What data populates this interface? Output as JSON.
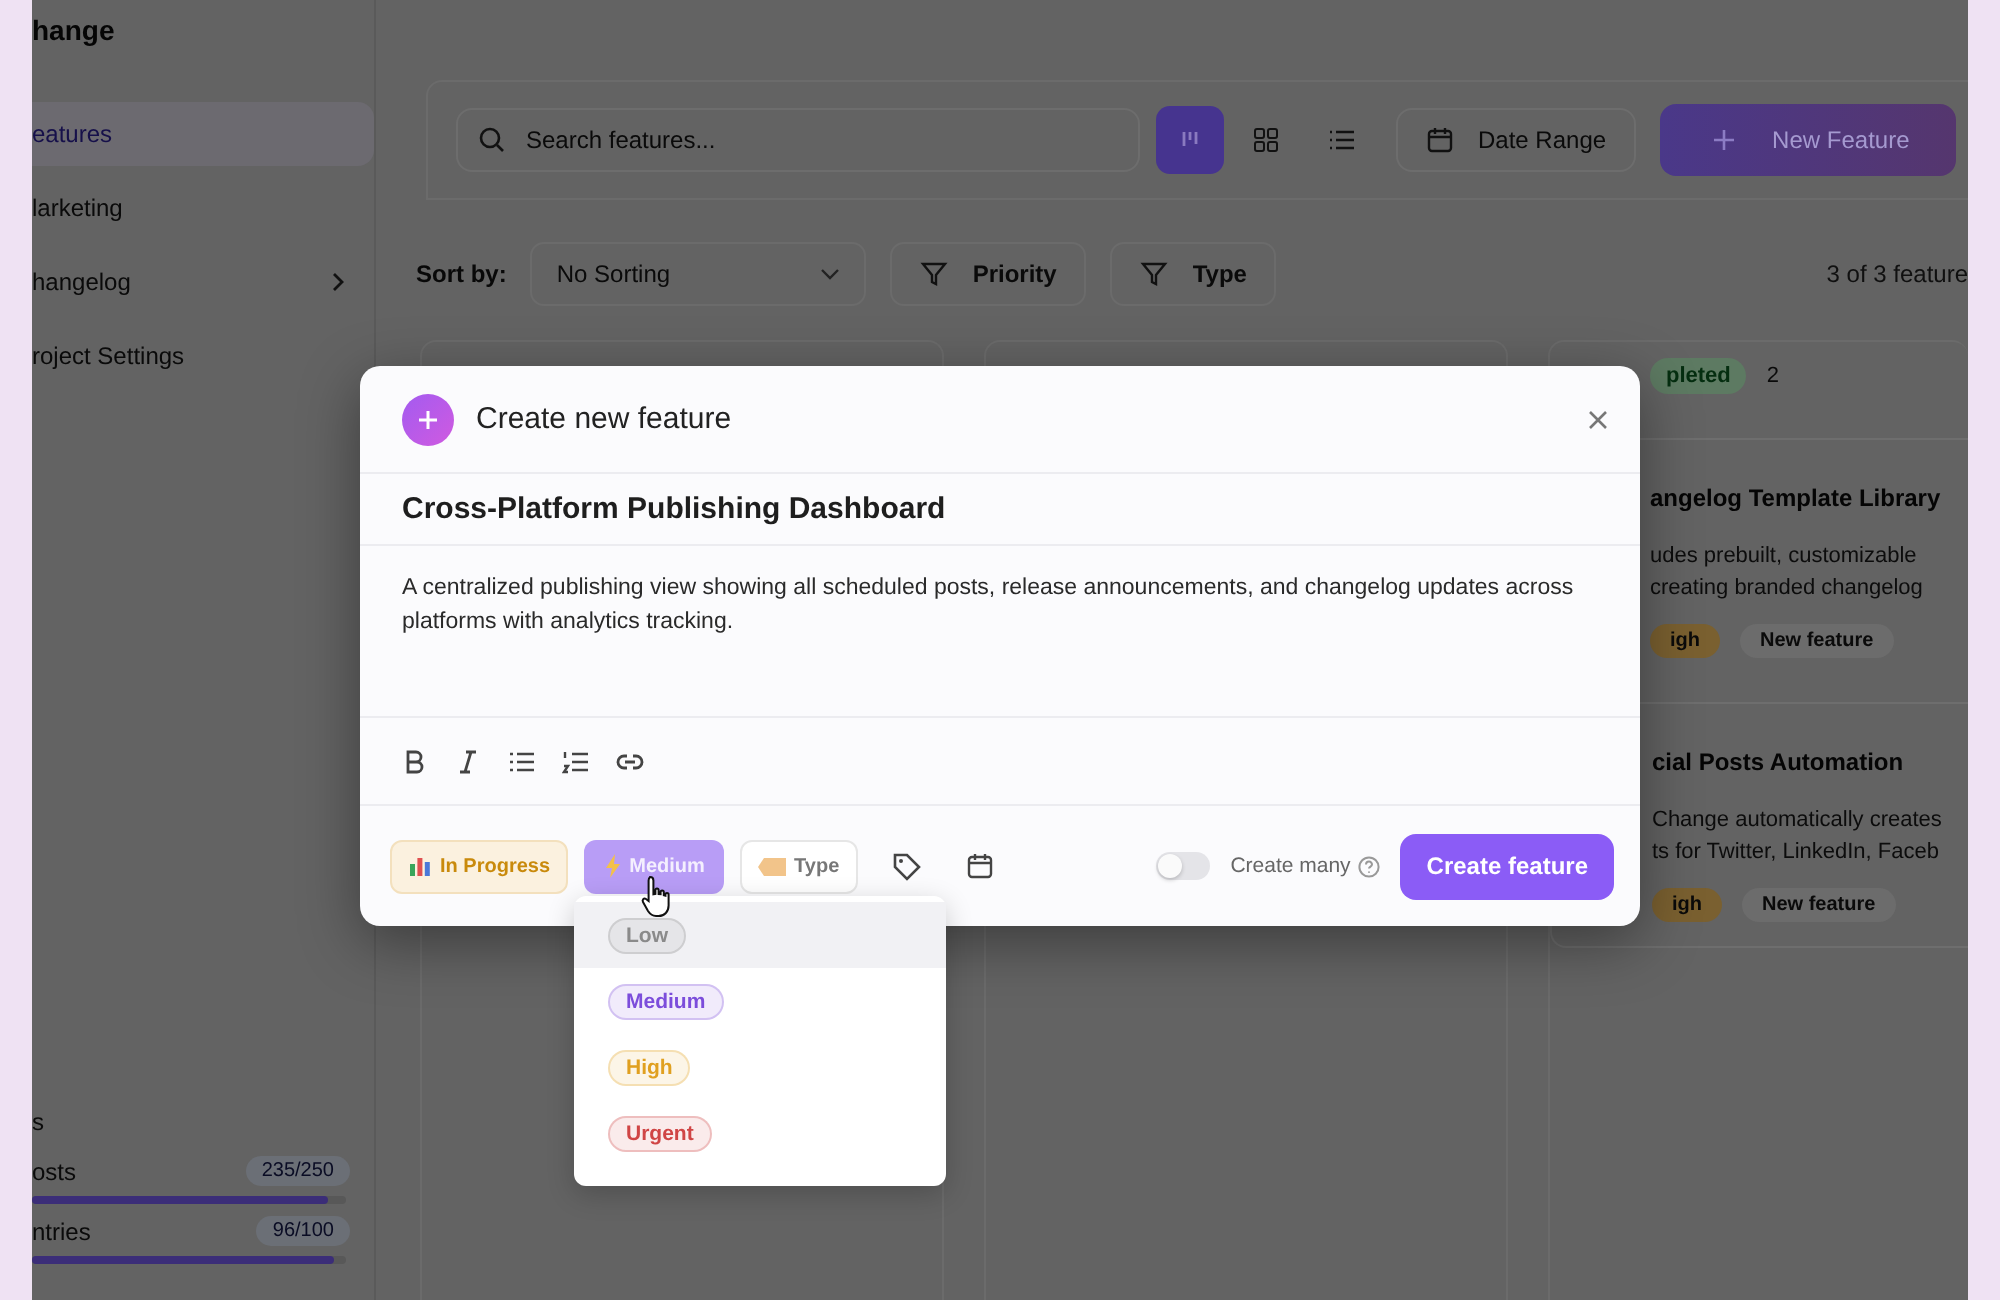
{
  "app": {
    "brand": "hange"
  },
  "sidebar": {
    "items": [
      {
        "label": "eatures",
        "selected": true,
        "expandable": false
      },
      {
        "label": "larketing",
        "selected": false,
        "expandable": false
      },
      {
        "label": "hangelog",
        "selected": false,
        "expandable": true
      },
      {
        "label": "roject Settings",
        "selected": false,
        "expandable": false
      }
    ],
    "usage_heading": "s",
    "usage": [
      {
        "label": "osts",
        "count": "235/250",
        "level": 0.94
      },
      {
        "label": "ntries",
        "count": "96/100",
        "level": 0.96
      }
    ]
  },
  "toolbar": {
    "search": {
      "placeholder": "Search features..."
    },
    "views": [
      {
        "kind": "board",
        "selected": true
      },
      {
        "kind": "grid",
        "selected": false
      },
      {
        "kind": "list",
        "selected": false
      }
    ],
    "date_range": "Date Range",
    "new_button": "New Feature"
  },
  "filters": {
    "sort_label": "Sort by:",
    "sort_value": "No Sorting",
    "filters": [
      "Priority",
      "Type"
    ],
    "count": "3 of 3 feature"
  },
  "board": {
    "status": "pleted",
    "count": "2",
    "cards": [
      {
        "title": "angelog Template Library",
        "lines": [
          "udes prebuilt, customizable",
          "creating branded changelog"
        ],
        "tags": [
          {
            "label": "igh",
            "color": "#7a6030"
          },
          {
            "label": "New feature",
            "color": "#6c6c6c"
          }
        ]
      },
      {
        "title": "cial Posts Automation",
        "lines": [
          "Change automatically creates",
          "ts for Twitter, LinkedIn, Faceb"
        ],
        "tags": [
          {
            "label": "igh",
            "color": "#7a6030"
          },
          {
            "label": "New feature",
            "color": "#6c6c6c"
          }
        ]
      }
    ]
  },
  "modal": {
    "title": "Create new feature",
    "feature_title": "Cross-Platform Publishing Dashboard",
    "description": "A centralized publishing view showing all scheduled posts, release announcements, and changelog updates across platforms with analytics tracking.",
    "format_tools": [
      {
        "kind": "bold"
      },
      {
        "kind": "italic"
      },
      {
        "kind": "bullets"
      },
      {
        "kind": "numbered"
      },
      {
        "kind": "link"
      }
    ],
    "status": "In Progress",
    "priority": "Medium",
    "type": "Type",
    "create_many": {
      "label": "Create many",
      "on": false
    },
    "submit": "Create feature",
    "priority_menu": [
      {
        "label": "Low",
        "color": "#8a8a8a",
        "highlighted": true
      },
      {
        "label": "Medium",
        "color": "#7c4ddb",
        "highlighted": false
      },
      {
        "label": "High",
        "color": "#e0a020",
        "highlighted": false
      },
      {
        "label": "Urgent",
        "color": "#d04545",
        "highlighted": false
      }
    ]
  }
}
